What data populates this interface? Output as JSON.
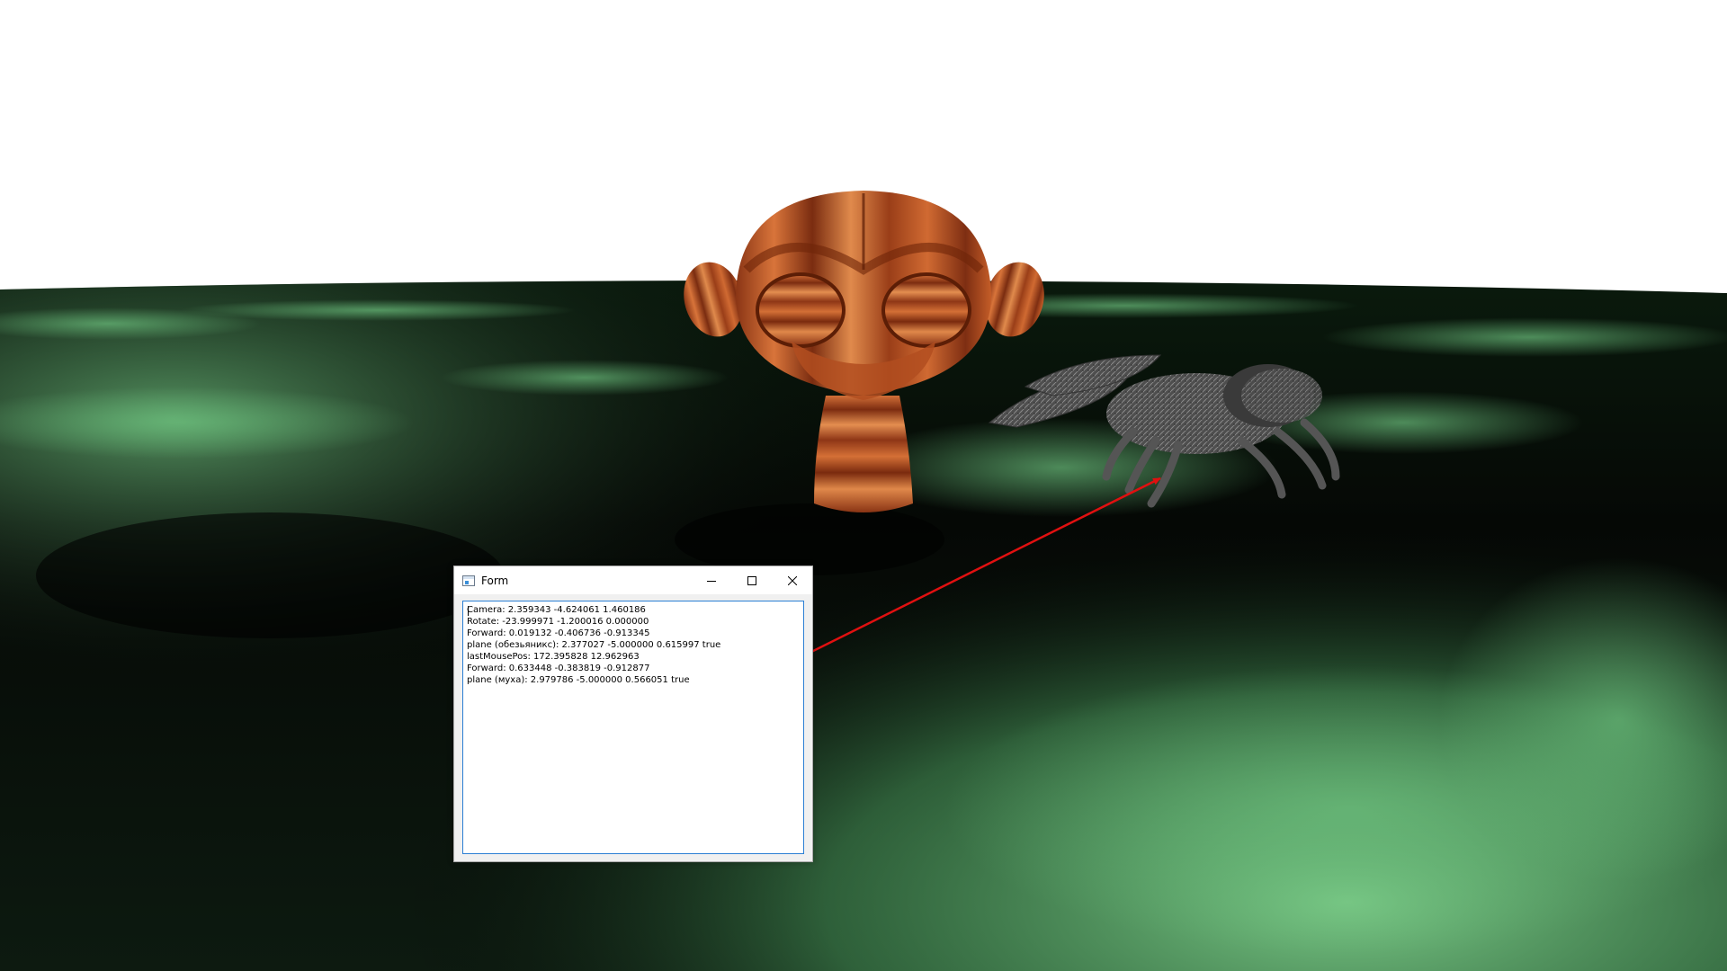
{
  "window": {
    "title": "Form",
    "buttons": {
      "minimize": "minimize",
      "maximize": "maximize",
      "close": "close"
    }
  },
  "log": {
    "lines": [
      "Camera: 2.359343 -4.624061 1.460186",
      "Rotate: -23.999971 -1.200016 0.000000",
      "Forward: 0.019132 -0.406736 -0.913345",
      "plane (обезьяникс): 2.377027 -5.000000 0.615997 true",
      "lastMousePos: 172.395828 12.962963",
      "Forward: 0.633448 -0.383819 -0.912877",
      "plane (муха): 2.979786 -5.000000 0.566051 true"
    ]
  },
  "scene": {
    "sky_color": "#ffffff",
    "ground_dark": "#000000",
    "ground_light": "#7fd18c",
    "monkey_color": "#c4582a",
    "fly_color": "#5a5a5a",
    "arrow_color": "#e01010"
  }
}
